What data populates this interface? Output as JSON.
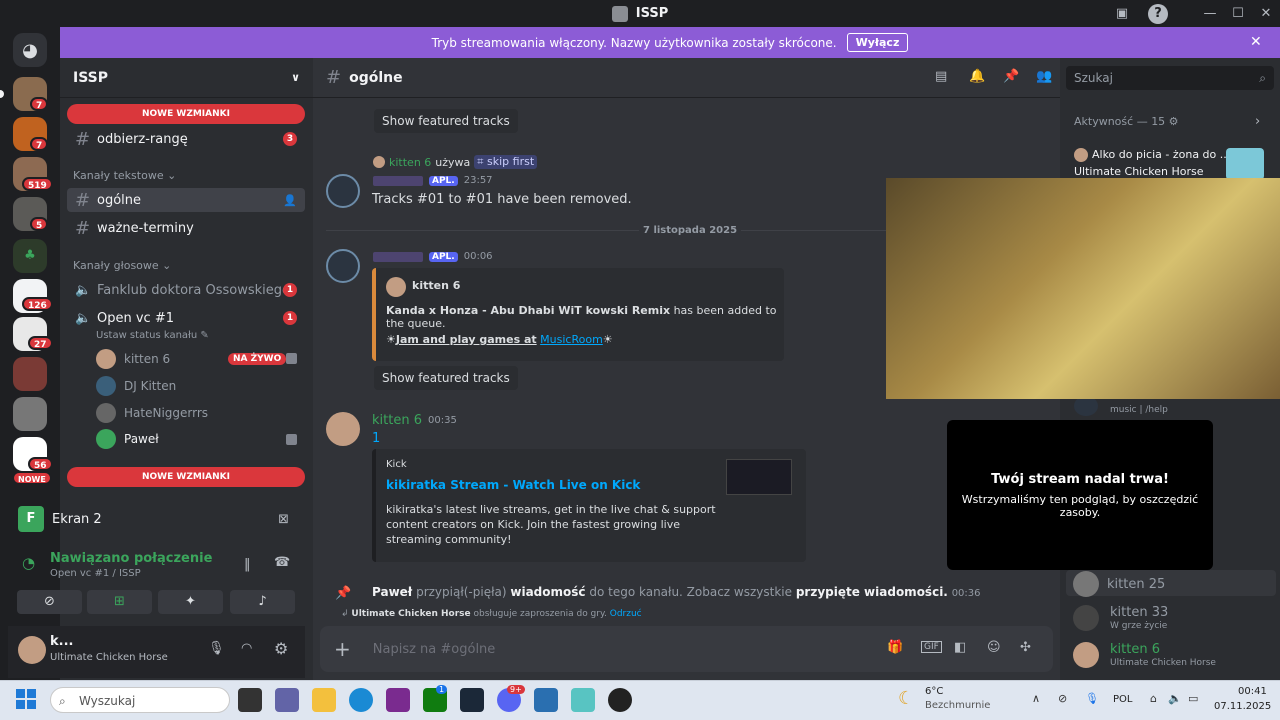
{
  "window": {
    "title": "ISSP"
  },
  "banner": {
    "text": "Tryb streamowania włączony. Nazwy użytkownika zostały skrócone.",
    "button": "Wyłącz"
  },
  "rail": {
    "badges": [
      "7",
      "7",
      "519",
      "5",
      "126",
      "27",
      "56"
    ],
    "nowe": "NOWE"
  },
  "server": {
    "name": "ISSP"
  },
  "sidebar": {
    "new_mentions": "NOWE WZMIANKI",
    "channel_odbierz": "odbierz-rangę",
    "channel_odbierz_badge": "3",
    "cat_text": "Kanały tekstowe",
    "channel_ogolne": "ogólne",
    "channel_wazne": "ważne-terminy",
    "cat_voice": "Kanały głosowe",
    "voice_fanklub": "Fanklub doktora Ossowskiego",
    "voice_fanklub_badge": "1",
    "voice_open": "Open vc #1",
    "voice_open_badge": "1",
    "voice_status": "Ustaw status kanału",
    "users": [
      {
        "name": "kitten 6",
        "live": "NA ŻYWO"
      },
      {
        "name": "DJ Kitten"
      },
      {
        "name": "HateNiggerrrs"
      },
      {
        "name": "Paweł"
      }
    ]
  },
  "voice_panel": {
    "screen": "Ekran 2",
    "status": "Nawiązano połączenie",
    "location": "Open vc #1 / ISSP"
  },
  "user_panel": {
    "name": "k...",
    "activity": "Ultimate Chicken Horse"
  },
  "channel_header": {
    "name": "ogólne",
    "search_placeholder": "Szukaj"
  },
  "messages": {
    "featured_btn": "Show featured tracks",
    "reply_user": "kitten 6",
    "reply_uses": "używa",
    "reply_cmd": "skip first",
    "bot_tag": "APL.",
    "m1_time": "23:57",
    "m1_text": "Tracks #01 to #01 have been removed.",
    "date_divider": "7 listopada 2025",
    "m2_time": "00:06",
    "m2_embed_author": "kitten 6",
    "m2_track": "Kanda x Honza - Abu Dhabi WiT kowski Remix",
    "m2_track_suffix": "has been added to the queue.",
    "m2_jam": "Jam and play games at",
    "m2_musicroom": "MusicRoom",
    "m3_user": "kitten 6",
    "m3_time": "00:35",
    "m3_text": "1",
    "m3_provider": "Kick",
    "m3_link": "kikiratka Stream - Watch Live on Kick",
    "m3_desc": "Get in the live chat & support content creators",
    "m3_desc_full": "kikiratka's latest live streams, get in the live chat & support content creators on Kick. Join the fastest growing live streaming community!",
    "pin_user": "Paweł",
    "pin_text1": "przypiął(-pięła)",
    "pin_text2": "wiadomość",
    "pin_text3": "do tego kanału. Zobacz wszystkie",
    "pin_text4": "przypięte wiadomości.",
    "pin_time": "00:36",
    "invite_game": "Ultimate Chicken Horse",
    "invite_text": "obsługuje zaproszenia do gry.",
    "invite_dismiss": "Odrzuć"
  },
  "composer": {
    "placeholder": "Napisz na #ogólne"
  },
  "members": {
    "activity_header": "Aktywność — 15",
    "act1_title": "Alko do picia - żona do ...",
    "act1_game": "Ultimate Chicken Horse",
    "bot_status": "music | /help",
    "list": [
      {
        "name": "kitten 25",
        "sub": ""
      },
      {
        "name": "kitten 33",
        "sub": "W grze życie"
      },
      {
        "name": "kitten 6",
        "sub": "Ultimate Chicken Horse"
      }
    ]
  },
  "paused": {
    "title": "Twój stream nadal trwa!",
    "text": "Wstrzymaliśmy ten podgląd, by oszczędzić zasoby."
  },
  "taskbar": {
    "search": "Wyszukaj",
    "weather_temp": "6°C",
    "weather_desc": "Bezchmurnie",
    "lang": "POL",
    "time": "00:41",
    "date": "07.11.2025",
    "badge_xbox": "1",
    "badge_discord": "9+"
  }
}
